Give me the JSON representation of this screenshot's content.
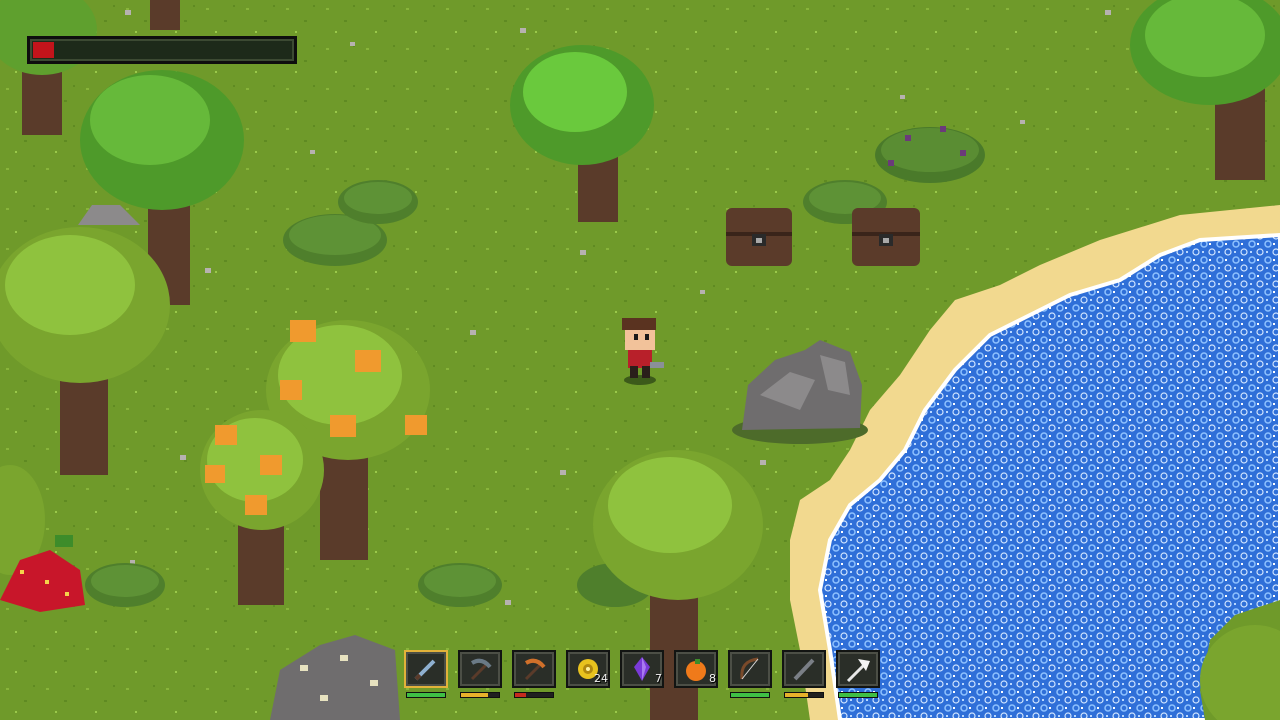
{
  "colors": {
    "grass": "#6f9a2a",
    "sand": "#f2d98f",
    "water": "#2f6fd8",
    "health": "#c2141b",
    "durability_green": "#3fbf45",
    "durability_yellow": "#e7b22b",
    "durability_red": "#c62a1e"
  },
  "hud": {
    "health_fraction": 0.08
  },
  "hotbar": {
    "selected_index": 0,
    "slots": [
      {
        "name": "sword",
        "icon": "sword-icon",
        "count": "",
        "durability": 1.0,
        "dur_color": "#3fbf45"
      },
      {
        "name": "pickaxe",
        "icon": "pickaxe-icon",
        "count": "",
        "durability": 0.7,
        "dur_color": "#e7b22b"
      },
      {
        "name": "copper-pickaxe",
        "icon": "copper-pickaxe-icon",
        "count": "",
        "durability": 0.3,
        "dur_color": "#c62a1e"
      },
      {
        "name": "gold-coin",
        "icon": "coin-icon",
        "count": "24"
      },
      {
        "name": "amethyst-crystal",
        "icon": "crystal-icon",
        "count": "7"
      },
      {
        "name": "orange-fruit",
        "icon": "orange-icon",
        "count": "8"
      },
      {
        "name": "bow",
        "icon": "bow-icon",
        "count": "",
        "durability": 1.0,
        "dur_color": "#3fbf45"
      },
      {
        "name": "staff",
        "icon": "staff-icon",
        "count": "",
        "durability": 0.6,
        "dur_color": "#e7b22b"
      },
      {
        "name": "white-axe",
        "icon": "axe-icon",
        "count": "",
        "durability": 1.0,
        "dur_color": "#3fbf45"
      }
    ]
  }
}
